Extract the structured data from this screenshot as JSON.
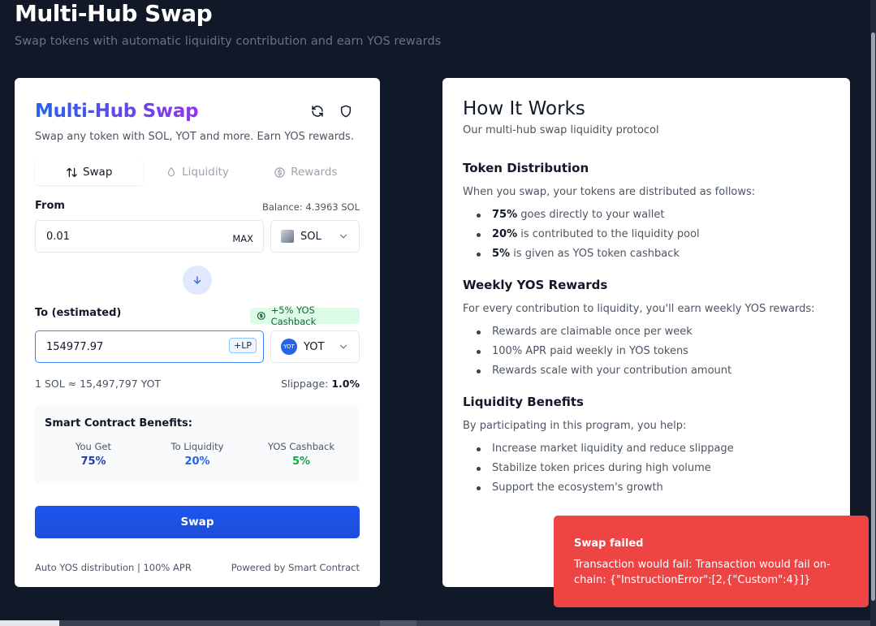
{
  "page": {
    "title": "Multi-Hub Swap",
    "subtitle": "Swap tokens with automatic liquidity contribution and earn YOS rewards"
  },
  "swap_card": {
    "title": "Multi-Hub Swap",
    "subtitle": "Swap any token with SOL, YOT and more. Earn YOS rewards.",
    "tabs": [
      {
        "label": "Swap",
        "icon": "swap-arrows-icon"
      },
      {
        "label": "Liquidity",
        "icon": "droplet-icon"
      },
      {
        "label": "Rewards",
        "icon": "dollar-circle-icon"
      }
    ],
    "from": {
      "label": "From",
      "balance": "Balance: 4.3963 SOL",
      "amount": "0.01",
      "max_label": "MAX",
      "token": "SOL"
    },
    "to": {
      "label": "To (estimated)",
      "cashback_badge": "+5% YOS Cashback",
      "amount": "154977.97",
      "lp_badge": "+LP",
      "token": "YOT",
      "token_icon_text": "YOT"
    },
    "rate": "1 SOL ≈ 15,497,797 YOT",
    "slippage_label": "Slippage:",
    "slippage_value": "1.0%",
    "benefits": {
      "title": "Smart Contract Benefits:",
      "items": [
        {
          "label": "You Get",
          "value": "75%",
          "color": "#1e40af"
        },
        {
          "label": "To Liquidity",
          "value": "20%",
          "color": "#2563eb"
        },
        {
          "label": "YOS Cashback",
          "value": "5%",
          "color": "#16a34a"
        }
      ]
    },
    "swap_button": "Swap",
    "footer_left": "Auto YOS distribution | 100% APR",
    "footer_right": "Powered by Smart Contract"
  },
  "info_card": {
    "title": "How It Works",
    "subtitle": "Our multi-hub swap liquidity protocol",
    "sections": [
      {
        "heading": "Token Distribution",
        "desc": "When you swap, your tokens are distributed as follows:",
        "items": [
          {
            "bold": "75%",
            "text": " goes directly to your wallet"
          },
          {
            "bold": "20%",
            "text": " is contributed to the liquidity pool"
          },
          {
            "bold": "5%",
            "text": " is given as YOS token cashback"
          }
        ]
      },
      {
        "heading": "Weekly YOS Rewards",
        "desc": "For every contribution to liquidity, you'll earn weekly YOS rewards:",
        "items": [
          {
            "bold": "",
            "text": "Rewards are claimable once per week"
          },
          {
            "bold": "",
            "text": "100% APR paid weekly in YOS tokens"
          },
          {
            "bold": "",
            "text": "Rewards scale with your contribution amount"
          }
        ]
      },
      {
        "heading": "Liquidity Benefits",
        "desc": "By participating in this program, you help:",
        "items": [
          {
            "bold": "",
            "text": "Increase market liquidity and reduce slippage"
          },
          {
            "bold": "",
            "text": "Stabilize token prices during high volume"
          },
          {
            "bold": "",
            "text": "Support the ecosystem's growth"
          }
        ]
      }
    ]
  },
  "toast": {
    "title": "Swap failed",
    "message": "Transaction would fail: Transaction would fail on-chain: {\"InstructionError\":[2,{\"Custom\":4}]}"
  },
  "colors": {
    "background": "#111827",
    "primary": "#1d4ed8",
    "error": "#ef4444",
    "success": "#16a34a"
  }
}
